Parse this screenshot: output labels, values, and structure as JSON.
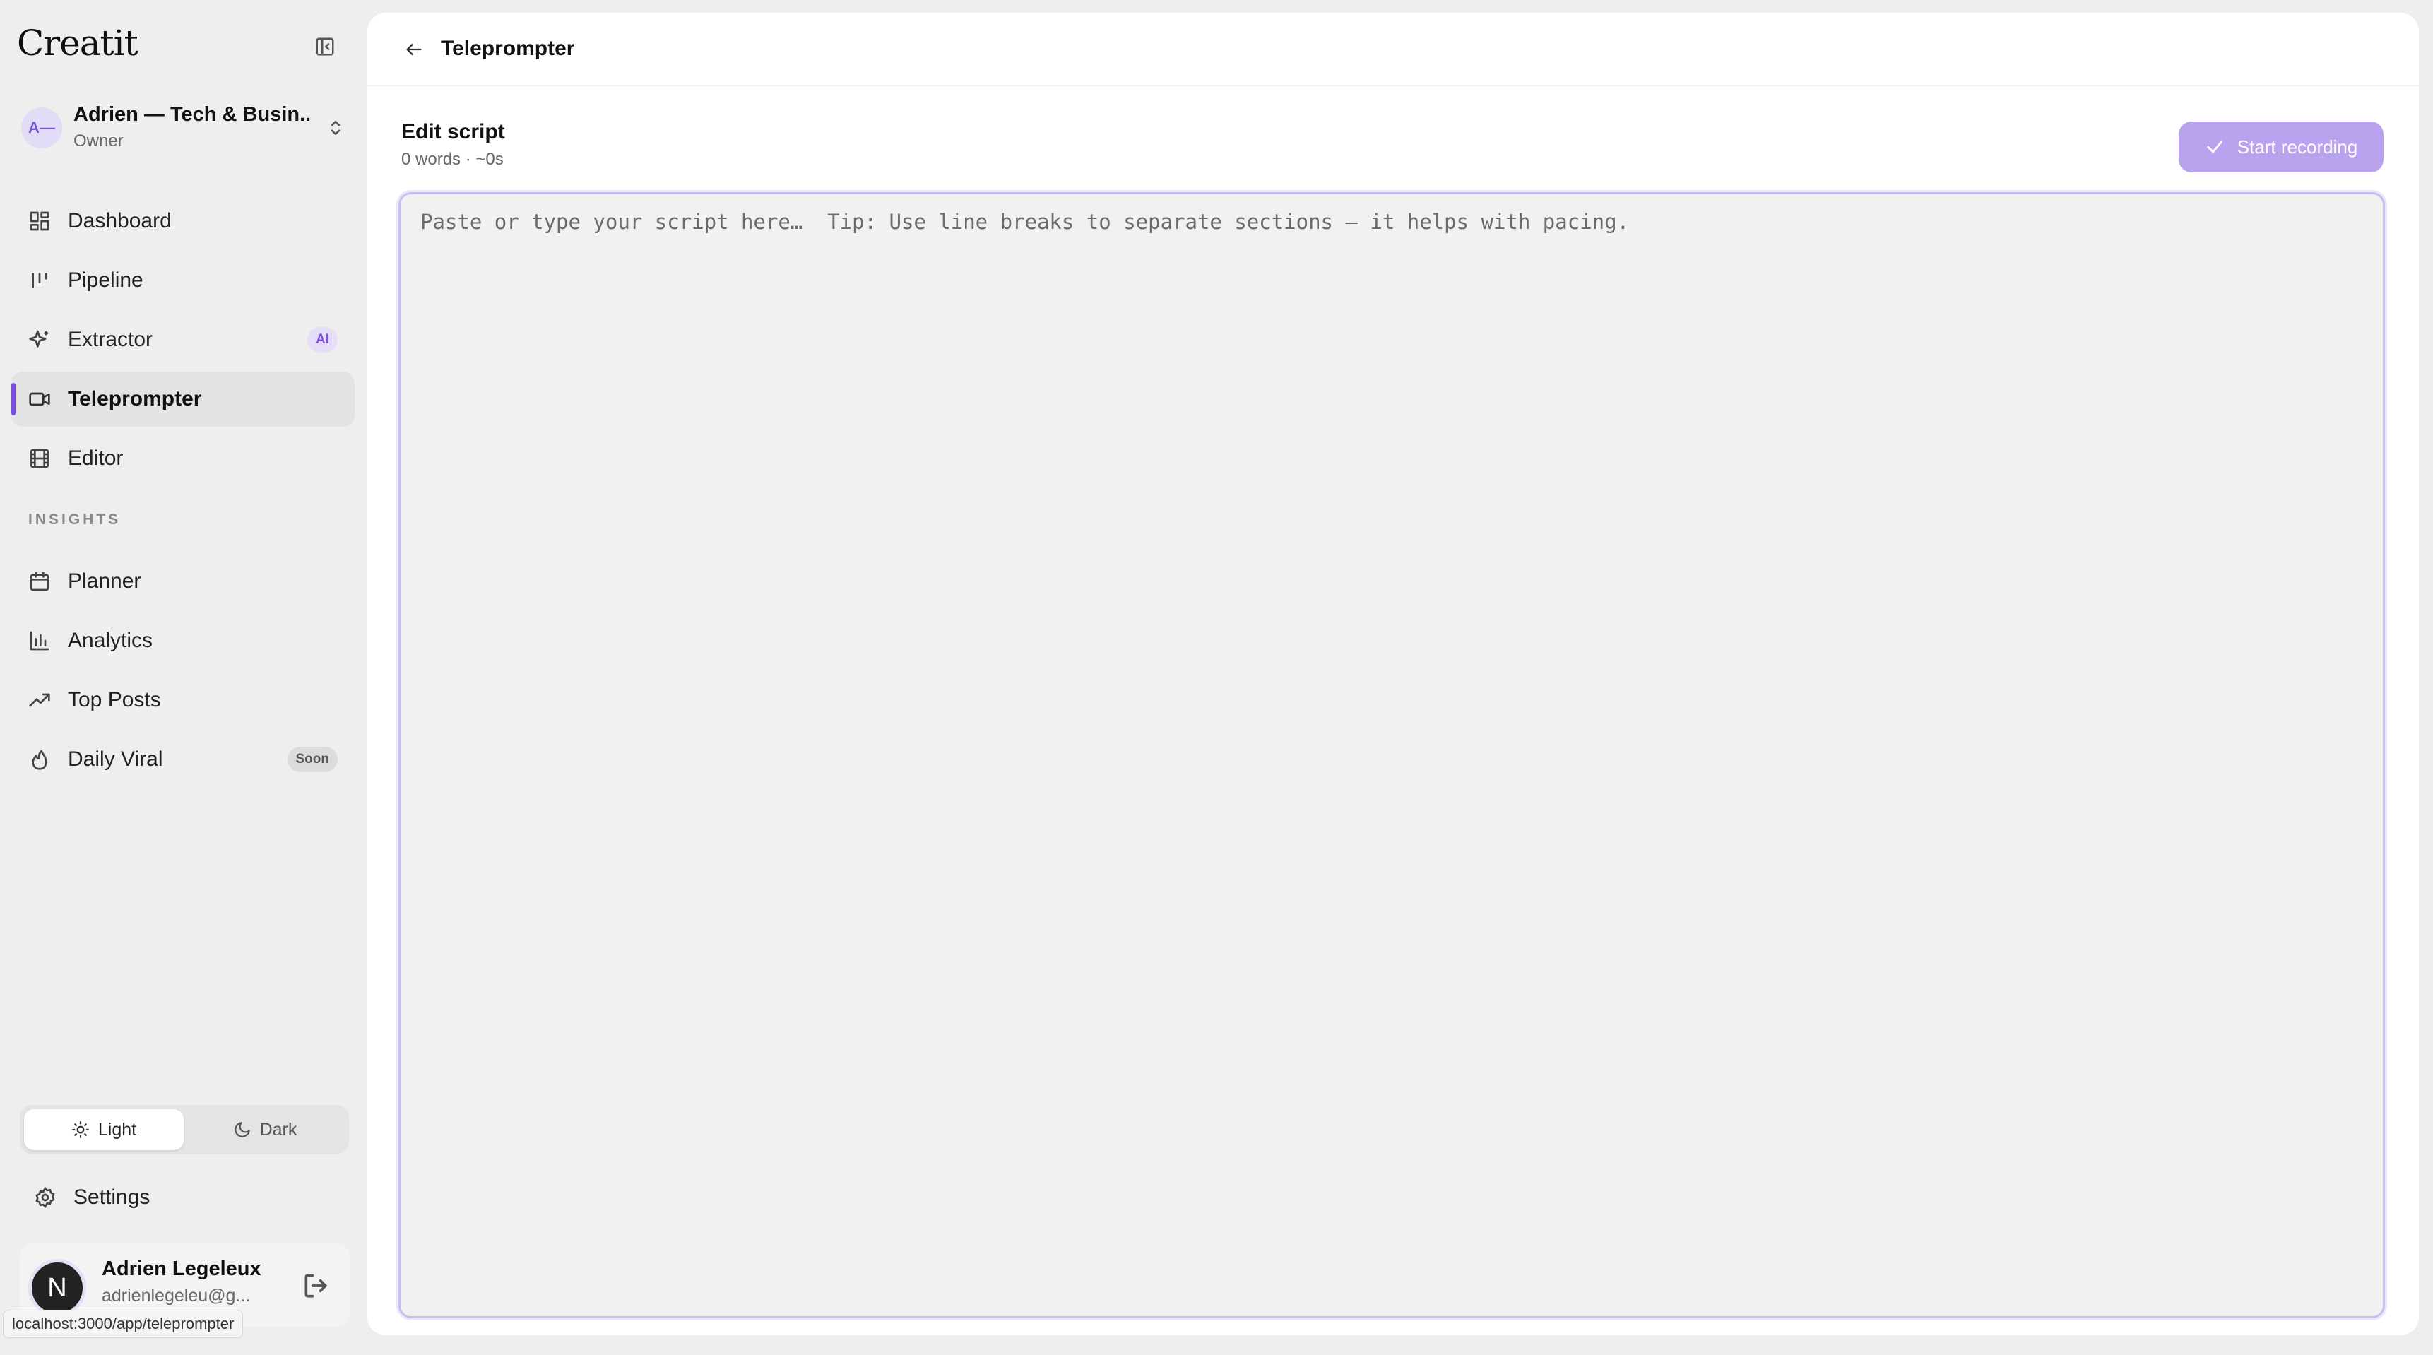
{
  "app": {
    "name": "Creatit"
  },
  "account": {
    "initials": "A—",
    "name": "Adrien — Tech & Busin...",
    "role": "Owner"
  },
  "nav": [
    {
      "label": "Dashboard",
      "icon": "dashboard-icon"
    },
    {
      "label": "Pipeline",
      "icon": "pipeline-icon"
    },
    {
      "label": "Extractor",
      "icon": "sparkle-icon",
      "badge": "AI"
    },
    {
      "label": "Teleprompter",
      "icon": "video-icon",
      "active": true
    },
    {
      "label": "Editor",
      "icon": "film-icon"
    }
  ],
  "insights": {
    "label": "INSIGHTS",
    "items": [
      {
        "label": "Planner",
        "icon": "calendar-icon"
      },
      {
        "label": "Analytics",
        "icon": "bar-chart-icon"
      },
      {
        "label": "Top Posts",
        "icon": "trending-up-icon"
      },
      {
        "label": "Daily Viral",
        "icon": "flame-icon",
        "badge": "Soon"
      }
    ]
  },
  "theme": {
    "light_label": "Light",
    "dark_label": "Dark",
    "selected": "Light"
  },
  "settings": {
    "label": "Settings"
  },
  "user": {
    "initial": "N",
    "name": "Adrien Legeleux",
    "email": "adrienlegeleu@g..."
  },
  "status_url": "localhost:3000/app/teleprompter",
  "header": {
    "title": "Teleprompter"
  },
  "editor": {
    "title": "Edit script",
    "meta": "0 words · ~0s",
    "record_label": "Start recording",
    "placeholder": "Paste or type your script here…  Tip: Use line breaks to separate sections — it helps with pacing.",
    "value": ""
  },
  "colors": {
    "accent": "#7a4fe0",
    "record_button": "#b9a3ef",
    "sidebar_bg": "#eeeeee"
  }
}
